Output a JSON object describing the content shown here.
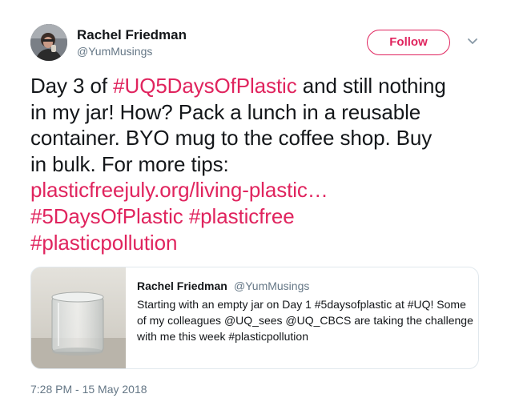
{
  "author": {
    "name": "Rachel Friedman",
    "handle": "@YumMusings"
  },
  "header": {
    "follow_label": "Follow",
    "menu_icon": "chevron-down-icon"
  },
  "tweet": {
    "line1": {
      "a": "Day 3 of ",
      "b": "#UQ5DaysOfPlastic",
      "c": " and still nothing"
    },
    "line2": "in my jar! How? Pack a lunch in a reusable",
    "line3": "container. BYO mug to the coffee shop. Buy",
    "line4": "in bulk. For more tips:",
    "link": "plasticfreejuly.org/living-plastic…",
    "hashtag1": "#5DaysOfPlastic",
    "hashtag2": "#plasticfree",
    "hashtag3": "#plasticpollution"
  },
  "quote": {
    "name": "Rachel Friedman",
    "handle": "@YumMusings",
    "line1": "Starting with an empty jar on Day 1 #5daysofplastic at #UQ! Some",
    "line2": "of my colleagues @UQ_sees @UQ_CBCS are taking the challenge",
    "line3": "with me this week #plasticpollution"
  },
  "timestamp": "7:28 PM - 15 May 2018",
  "colors": {
    "accent": "#e0245e",
    "text": "#14171a",
    "secondary": "#657786",
    "border": "#e1e8ed"
  }
}
